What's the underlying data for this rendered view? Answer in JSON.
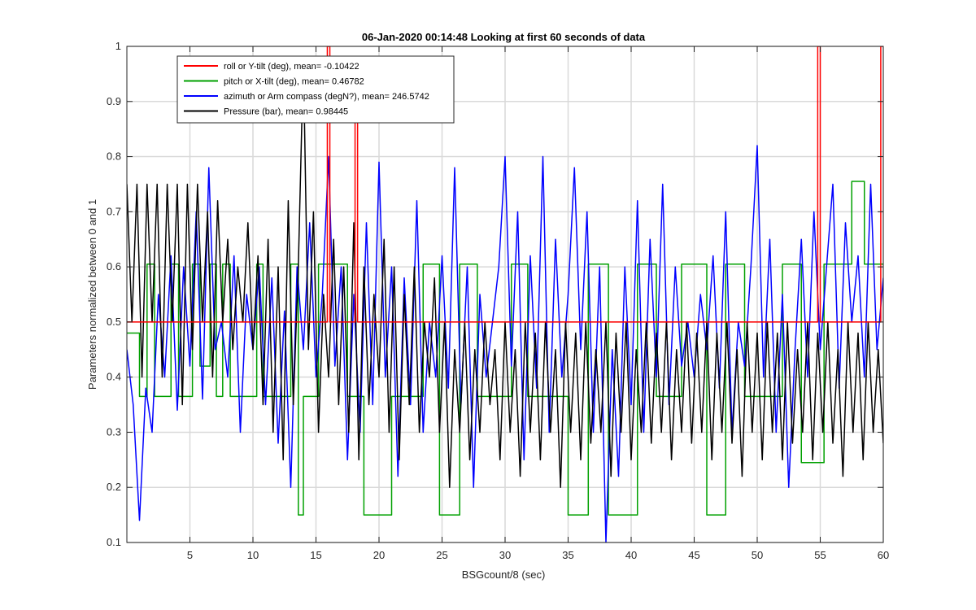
{
  "chart_data": {
    "type": "line",
    "title": "06-Jan-2020 00:14:48 Looking at first 60 seconds of data",
    "xlabel": "BSGcount/8 (sec)",
    "ylabel": "Parameters normalized between 0 and 1",
    "xlim": [
      0,
      60
    ],
    "ylim": [
      0.1,
      1
    ],
    "xticks": [
      5,
      10,
      15,
      20,
      25,
      30,
      35,
      40,
      45,
      50,
      55,
      60
    ],
    "yticks": [
      0.1,
      0.2,
      0.3,
      0.4,
      0.5,
      0.6,
      0.7,
      0.8,
      0.9,
      1
    ],
    "grid": true,
    "legend_position": "top-left",
    "series": [
      {
        "name": "roll or Y-tilt (deg), mean= -0.10422",
        "color": "#ff0000",
        "x": [
          0,
          15.9,
          15.9,
          16.1,
          16.1,
          18.1,
          18.1,
          18.3,
          18.3,
          54.8,
          54.8,
          55.0,
          55.0,
          59.8,
          59.8,
          60.0
        ],
        "y": [
          0.5,
          0.5,
          1.0,
          1.0,
          0.5,
          0.5,
          0.98,
          0.98,
          0.5,
          0.5,
          1.0,
          1.0,
          0.5,
          0.5,
          1.0,
          1.0
        ]
      },
      {
        "name": "pitch or X-tilt (deg), mean= 0.46782",
        "color": "#00a000",
        "x": [
          0,
          1.0,
          1.0,
          1.6,
          1.6,
          2.2,
          2.2,
          3.5,
          3.5,
          4.1,
          4.1,
          5.2,
          5.2,
          5.8,
          5.8,
          6.6,
          6.6,
          7.1,
          7.1,
          7.6,
          7.6,
          8.2,
          8.2,
          10.3,
          10.3,
          10.8,
          10.8,
          13.0,
          13.0,
          13.6,
          13.6,
          14.0,
          14.0,
          15.2,
          15.2,
          17.5,
          17.5,
          18.8,
          18.8,
          21.0,
          21.0,
          23.5,
          23.5,
          24.8,
          24.8,
          26.4,
          26.4,
          27.8,
          27.8,
          30.5,
          30.5,
          31.8,
          31.8,
          35.0,
          35.0,
          36.6,
          36.6,
          38.2,
          38.2,
          40.5,
          40.5,
          42.0,
          42.0,
          44.0,
          44.0,
          46.0,
          46.0,
          47.5,
          47.5,
          49.0,
          49.0,
          52.0,
          52.0,
          53.5,
          53.5,
          55.3,
          55.3,
          57.5,
          57.5,
          58.5,
          58.5,
          60.0
        ],
        "y": [
          0.48,
          0.48,
          0.365,
          0.365,
          0.605,
          0.605,
          0.365,
          0.365,
          0.605,
          0.605,
          0.365,
          0.365,
          0.605,
          0.605,
          0.42,
          0.42,
          0.605,
          0.605,
          0.365,
          0.365,
          0.605,
          0.605,
          0.365,
          0.365,
          0.605,
          0.605,
          0.365,
          0.365,
          0.605,
          0.605,
          0.15,
          0.15,
          0.365,
          0.365,
          0.605,
          0.605,
          0.365,
          0.365,
          0.15,
          0.15,
          0.365,
          0.365,
          0.605,
          0.605,
          0.15,
          0.15,
          0.605,
          0.605,
          0.365,
          0.365,
          0.605,
          0.605,
          0.365,
          0.365,
          0.15,
          0.15,
          0.605,
          0.605,
          0.15,
          0.15,
          0.605,
          0.605,
          0.365,
          0.365,
          0.605,
          0.605,
          0.15,
          0.15,
          0.605,
          0.605,
          0.365,
          0.365,
          0.605,
          0.605,
          0.245,
          0.245,
          0.605,
          0.605,
          0.755,
          0.755,
          0.605,
          0.605
        ]
      },
      {
        "name": "azimuth or Arm compass (degN?), mean= 246.5742",
        "color": "#0000ff",
        "x": [
          0,
          0.5,
          1.0,
          1.5,
          2.0,
          2.5,
          3.0,
          3.5,
          4.0,
          4.5,
          5.0,
          5.5,
          6.0,
          6.5,
          7.0,
          7.5,
          8.0,
          8.5,
          9.0,
          9.5,
          10.0,
          10.5,
          11.0,
          11.5,
          12.0,
          12.5,
          13.0,
          13.5,
          14.0,
          14.5,
          15.0,
          15.5,
          16.0,
          16.5,
          17.0,
          17.5,
          18.0,
          18.5,
          19.0,
          19.5,
          20.0,
          20.5,
          21.0,
          21.5,
          22.0,
          22.5,
          23.0,
          23.5,
          24.0,
          24.5,
          25.0,
          25.5,
          26.0,
          26.5,
          27.0,
          27.5,
          28.0,
          28.5,
          29.0,
          29.5,
          30.0,
          30.5,
          31.0,
          31.5,
          32.0,
          32.5,
          33.0,
          33.5,
          34.0,
          34.5,
          35.0,
          35.5,
          36.0,
          36.5,
          37.0,
          37.5,
          38.0,
          38.5,
          39.0,
          39.5,
          40.0,
          40.5,
          41.0,
          41.5,
          42.0,
          42.5,
          43.0,
          43.5,
          44.0,
          44.5,
          45.0,
          45.5,
          46.0,
          46.5,
          47.0,
          47.5,
          48.0,
          48.5,
          49.0,
          49.5,
          50.0,
          50.5,
          51.0,
          51.5,
          52.0,
          52.5,
          53.0,
          53.5,
          54.0,
          54.5,
          55.0,
          55.5,
          56.0,
          56.5,
          57.0,
          57.5,
          58.0,
          58.5,
          59.0,
          59.5,
          60.0
        ],
        "y": [
          0.45,
          0.35,
          0.14,
          0.38,
          0.3,
          0.55,
          0.4,
          0.62,
          0.34,
          0.6,
          0.42,
          0.7,
          0.36,
          0.78,
          0.45,
          0.5,
          0.4,
          0.62,
          0.3,
          0.55,
          0.45,
          0.6,
          0.35,
          0.58,
          0.28,
          0.52,
          0.2,
          0.6,
          0.45,
          0.68,
          0.4,
          0.55,
          0.8,
          0.42,
          0.6,
          0.25,
          0.55,
          0.3,
          0.68,
          0.35,
          0.79,
          0.4,
          0.6,
          0.22,
          0.58,
          0.35,
          0.72,
          0.3,
          0.5,
          0.4,
          0.62,
          0.38,
          0.78,
          0.35,
          0.6,
          0.2,
          0.55,
          0.4,
          0.5,
          0.6,
          0.8,
          0.42,
          0.7,
          0.25,
          0.62,
          0.38,
          0.8,
          0.3,
          0.65,
          0.4,
          0.55,
          0.78,
          0.45,
          0.7,
          0.3,
          0.6,
          0.1,
          0.45,
          0.22,
          0.6,
          0.35,
          0.72,
          0.3,
          0.65,
          0.4,
          0.75,
          0.35,
          0.6,
          0.42,
          0.5,
          0.4,
          0.55,
          0.45,
          0.62,
          0.38,
          0.7,
          0.3,
          0.5,
          0.42,
          0.6,
          0.82,
          0.4,
          0.65,
          0.3,
          0.55,
          0.2,
          0.45,
          0.65,
          0.4,
          0.7,
          0.45,
          0.6,
          0.75,
          0.38,
          0.68,
          0.5,
          0.62,
          0.4,
          0.75,
          0.45,
          0.58
        ]
      },
      {
        "name": "Pressure (bar), mean= 0.98445",
        "color": "#000000",
        "x": [
          0,
          0.4,
          0.8,
          1.2,
          1.6,
          2.0,
          2.4,
          2.8,
          3.2,
          3.6,
          4.0,
          4.4,
          4.8,
          5.2,
          5.6,
          6.0,
          6.4,
          6.8,
          7.2,
          7.6,
          8.0,
          8.4,
          8.8,
          9.2,
          9.6,
          10.0,
          10.4,
          10.8,
          11.2,
          11.6,
          12.0,
          12.4,
          12.8,
          13.2,
          13.6,
          14.0,
          14.4,
          14.8,
          15.2,
          15.6,
          16.0,
          16.4,
          16.8,
          17.2,
          17.6,
          18.0,
          18.4,
          18.8,
          19.2,
          19.6,
          20.0,
          20.4,
          20.8,
          21.2,
          21.6,
          22.0,
          22.4,
          22.8,
          23.2,
          23.6,
          24.0,
          24.4,
          24.8,
          25.2,
          25.6,
          26.0,
          26.4,
          26.8,
          27.2,
          27.6,
          28.0,
          28.4,
          28.8,
          29.2,
          29.6,
          30.0,
          30.4,
          30.8,
          31.2,
          31.6,
          32.0,
          32.4,
          32.8,
          33.2,
          33.6,
          34.0,
          34.4,
          34.8,
          35.2,
          35.6,
          36.0,
          36.4,
          36.8,
          37.2,
          37.6,
          38.0,
          38.4,
          38.8,
          39.2,
          39.6,
          40.0,
          40.4,
          40.8,
          41.2,
          41.6,
          42.0,
          42.4,
          42.8,
          43.2,
          43.6,
          44.0,
          44.4,
          44.8,
          45.2,
          45.6,
          46.0,
          46.4,
          46.8,
          47.2,
          47.6,
          48.0,
          48.4,
          48.8,
          49.2,
          49.6,
          50.0,
          50.4,
          50.8,
          51.2,
          51.6,
          52.0,
          52.4,
          52.8,
          53.2,
          53.6,
          54.0,
          54.4,
          54.8,
          55.2,
          55.6,
          56.0,
          56.4,
          56.8,
          57.2,
          57.6,
          58.0,
          58.4,
          58.8,
          59.2,
          59.6,
          60.0
        ],
        "y": [
          0.75,
          0.5,
          0.75,
          0.4,
          0.75,
          0.5,
          0.75,
          0.4,
          0.75,
          0.5,
          0.75,
          0.35,
          0.75,
          0.45,
          0.75,
          0.5,
          0.7,
          0.4,
          0.72,
          0.5,
          0.65,
          0.45,
          0.6,
          0.5,
          0.68,
          0.45,
          0.62,
          0.35,
          0.65,
          0.3,
          0.6,
          0.25,
          0.72,
          0.35,
          0.6,
          0.98,
          0.45,
          0.7,
          0.3,
          0.55,
          0.4,
          0.65,
          0.35,
          0.6,
          0.3,
          0.68,
          0.25,
          0.6,
          0.35,
          0.55,
          0.4,
          0.65,
          0.3,
          0.6,
          0.25,
          0.55,
          0.35,
          0.6,
          0.3,
          0.5,
          0.4,
          0.58,
          0.3,
          0.5,
          0.2,
          0.45,
          0.3,
          0.5,
          0.25,
          0.45,
          0.3,
          0.5,
          0.35,
          0.45,
          0.25,
          0.5,
          0.3,
          0.45,
          0.22,
          0.5,
          0.3,
          0.48,
          0.25,
          0.5,
          0.3,
          0.45,
          0.2,
          0.5,
          0.3,
          0.48,
          0.25,
          0.5,
          0.28,
          0.45,
          0.3,
          0.5,
          0.22,
          0.48,
          0.3,
          0.5,
          0.25,
          0.45,
          0.3,
          0.5,
          0.28,
          0.48,
          0.3,
          0.5,
          0.25,
          0.45,
          0.3,
          0.5,
          0.28,
          0.48,
          0.3,
          0.5,
          0.25,
          0.48,
          0.3,
          0.5,
          0.28,
          0.45,
          0.22,
          0.5,
          0.3,
          0.48,
          0.25,
          0.5,
          0.3,
          0.48,
          0.25,
          0.5,
          0.28,
          0.45,
          0.3,
          0.5,
          0.25,
          0.48,
          0.3,
          0.5,
          0.28,
          0.45,
          0.22,
          0.5,
          0.3,
          0.48,
          0.25,
          0.5,
          0.3,
          0.45,
          0.28
        ]
      }
    ]
  }
}
